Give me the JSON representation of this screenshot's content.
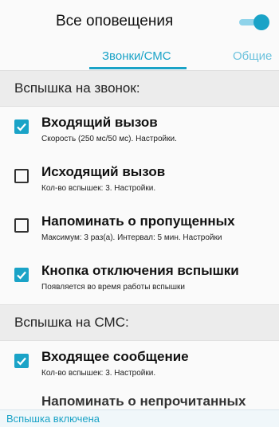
{
  "header": {
    "title": "Все оповещения",
    "toggle_on": true
  },
  "tabs": [
    {
      "label": "Звонки/СМС",
      "active": true
    },
    {
      "label": "Общие",
      "active": false
    }
  ],
  "sections": [
    {
      "title": "Вспышка на звонок:",
      "items": [
        {
          "label": "Входящий вызов",
          "sub": "Скорость (250 мс/50 мс). Настройки.",
          "checked": true
        },
        {
          "label": "Исходящий вызов",
          "sub": "Кол-во вспышек: 3. Настройки.",
          "checked": false
        },
        {
          "label": "Напоминать о пропущенных",
          "sub": "Максимум: 3 раз(а). Интервал: 5 мин. Настройки",
          "checked": false
        },
        {
          "label": "Кнопка отключения вспышки",
          "sub": "Появляется во время работы вспышки",
          "checked": true
        }
      ]
    },
    {
      "title": "Вспышка на СМС:",
      "items": [
        {
          "label": "Входящее сообщение",
          "sub": "Кол-во вспышек: 3. Настройки.",
          "checked": true
        }
      ]
    }
  ],
  "partial_item_label": "Напоминать о непрочитанных",
  "status_bar": "Вспышка включена",
  "colors": {
    "accent": "#1aa3c7",
    "section_bg": "#ececec",
    "page_bg": "#fafafa"
  },
  "icons": {
    "checkbox_checked": "check-icon"
  }
}
